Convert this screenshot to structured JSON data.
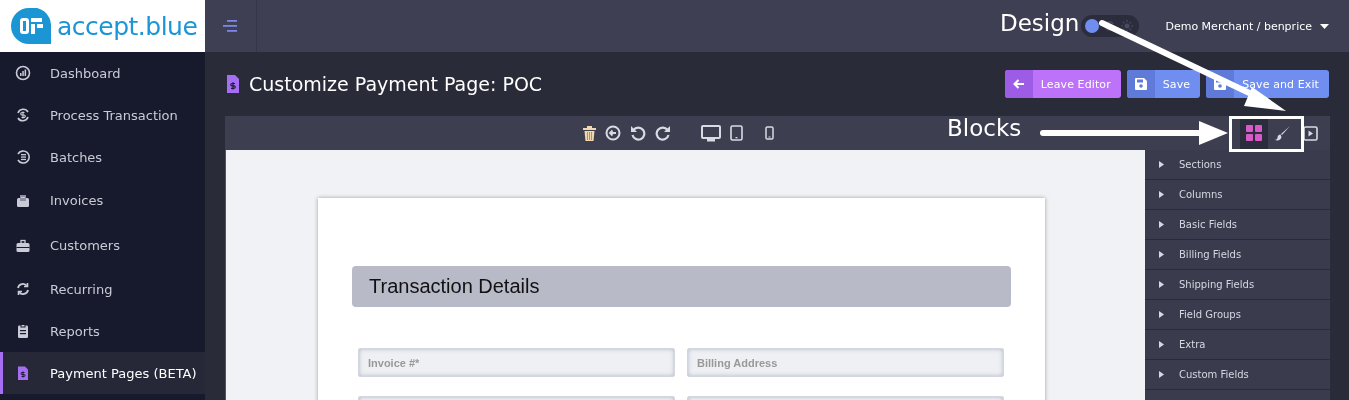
{
  "logo": {
    "text": "accept.blue"
  },
  "sidebar": {
    "items": [
      {
        "label": "Dashboard",
        "selected": false
      },
      {
        "label": "Process Transaction",
        "selected": false
      },
      {
        "label": "Batches",
        "selected": false
      },
      {
        "label": "Invoices",
        "selected": false
      },
      {
        "label": "Customers",
        "selected": false
      },
      {
        "label": "Recurring",
        "selected": false
      },
      {
        "label": "Reports",
        "selected": false
      },
      {
        "label": "Payment Pages (BETA)",
        "selected": true
      }
    ]
  },
  "topbar": {
    "theme_toggle": {
      "on": true
    },
    "user_menu": "Demo Merchant / benprice"
  },
  "page": {
    "title": "Customize Payment Page: POC",
    "buttons": [
      {
        "label": "Leave Editor",
        "kind": "leave"
      },
      {
        "label": "Save",
        "kind": "save"
      },
      {
        "label": "Save and Exit",
        "kind": "save"
      }
    ]
  },
  "editor": {
    "panel_tabs": [
      {
        "kind": "blocks",
        "selected": true
      },
      {
        "kind": "design",
        "selected": false
      },
      {
        "kind": "preview",
        "selected": false
      }
    ],
    "block_categories": [
      "Sections",
      "Columns",
      "Basic Fields",
      "Billing Fields",
      "Shipping Fields",
      "Field Groups",
      "Extra",
      "Custom Fields"
    ],
    "form": {
      "section_title": "Transaction Details",
      "fields": [
        {
          "placeholder": "Invoice #*"
        },
        {
          "placeholder": "Billing Address"
        }
      ]
    }
  },
  "annotations": [
    {
      "text": "Design"
    },
    {
      "text": "Blocks"
    }
  ]
}
